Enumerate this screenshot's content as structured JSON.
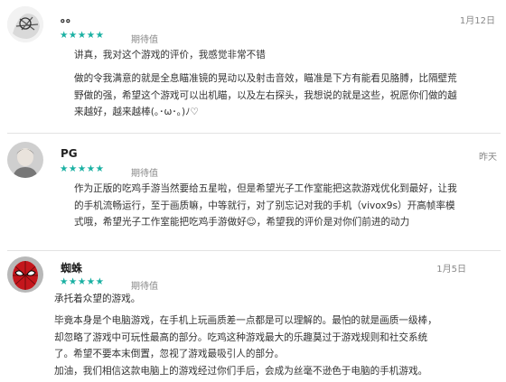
{
  "reviews": [
    {
      "name": "。。",
      "stars": "★★★★★",
      "star_label": "期待值",
      "date": "1月12日",
      "paragraphs": [
        "讲真，我对这个游戏的评价，我感觉非常不错",
        "做的令我满意的就是全息瞄准镜的晃动以及射击音效，瞄准是下方有能看见胳膊，比隔壁荒\n野做的强，希望这个游戏可以出机瞄，以及左右探头，我想说的就是这些，祝愿你们做的越\n来越好，越来越棒(｡･ω･｡)ﾉ♡"
      ]
    },
    {
      "name": "PG",
      "stars": "★★★★★",
      "star_label": "期待值",
      "date": "昨天",
      "paragraphs": [
        "作为正版的吃鸡手游当然要给五星啦，但是希望光子工作室能把这款游戏优化到最好，让我\n的手机流畅运行，至于画质嘛，中等就行，对了别忘记对我的手机（vivox9s）开高帧率模\n式哦，希望光子工作室能把吃鸡手游做好☺，希望我的评价是对你们前进的动力"
      ]
    },
    {
      "name": "蜘蛛",
      "stars": "★★★★★",
      "star_label": "期待值",
      "date": "1月5日",
      "paragraphs": [
        "承托着众望的游戏。",
        "毕竟本身是个电脑游戏，在手机上玩画质差一点都是可以理解的。最怕的就是画质一级棒，\n却忽略了游戏中可玩性最高的部分。吃鸡这种游戏最大的乐趣莫过于游戏规则和社交系统\n了。希望不要本末倒置，忽视了游戏最吸引人的部分。",
        "加油，我们相信这款电脑上的游戏经过你们手后，会成为丝毫不逊色于电脑的手机游戏。"
      ]
    }
  ],
  "colors": {
    "star": "#19b0a2",
    "muted": "#888888",
    "text": "#333333"
  }
}
